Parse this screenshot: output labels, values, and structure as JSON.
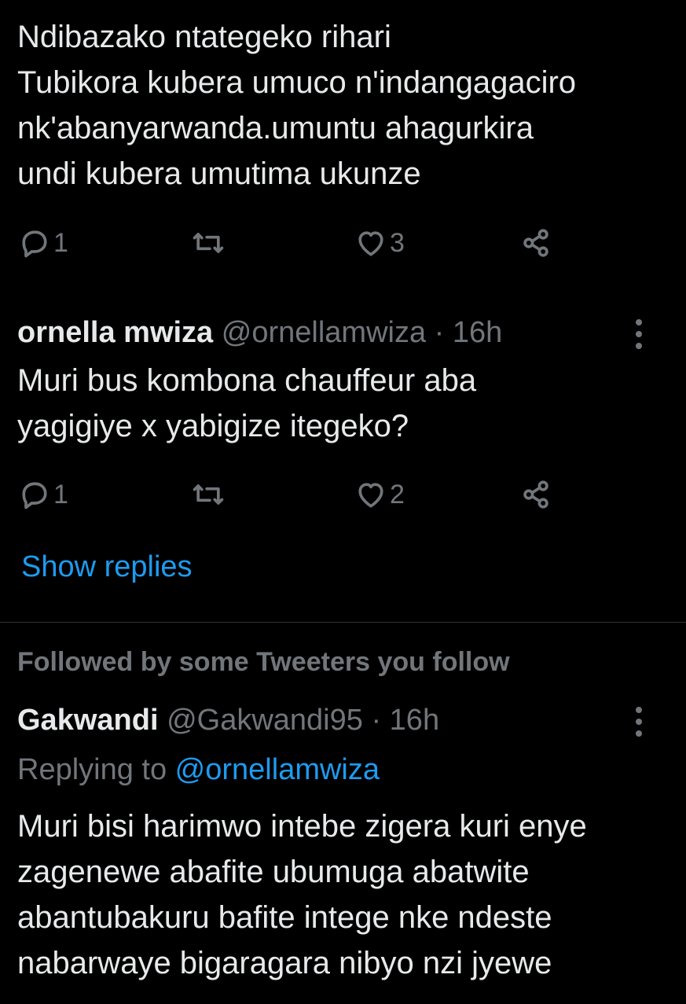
{
  "tweet1": {
    "text": "Ndibazako ntategeko rihari\nTubikora kubera umuco n'indangagaciro\nnk'abanyarwanda.umuntu ahagurkira\nundi kubera umutima ukunze",
    "reply_count": "1",
    "retweet_count": "",
    "like_count": "3"
  },
  "tweet2": {
    "display_name": "ornella mwiza",
    "handle": "@ornellamwiza",
    "separator": " · ",
    "time": "16h",
    "text": "Muri bus kombona chauffeur aba\nyagigiye x yabigize itegeko?",
    "reply_count": "1",
    "retweet_count": "",
    "like_count": "2",
    "show_replies": "Show replies"
  },
  "tweet3": {
    "context": "Followed by some Tweeters you follow",
    "display_name": "Gakwandi",
    "handle": "@Gakwandi95",
    "separator": " · ",
    "time": "16h",
    "replying_prefix": "Replying to ",
    "replying_handle": "@ornellamwiza",
    "text": "Muri bisi harimwo intebe zigera kuri enye\nzagenewe abafite ubumuga abatwite\nabantubakuru bafite intege nke ndeste\nnabarwaye bigaragara nibyo nzi jyewe"
  },
  "icons": [
    "reply-icon",
    "retweet-icon",
    "like-icon",
    "share-icon",
    "more-icon"
  ],
  "colors": {
    "background": "#000000",
    "text": "#e7e9ea",
    "muted": "#71767b",
    "link": "#1d9bf0",
    "divider": "#2f3336"
  }
}
